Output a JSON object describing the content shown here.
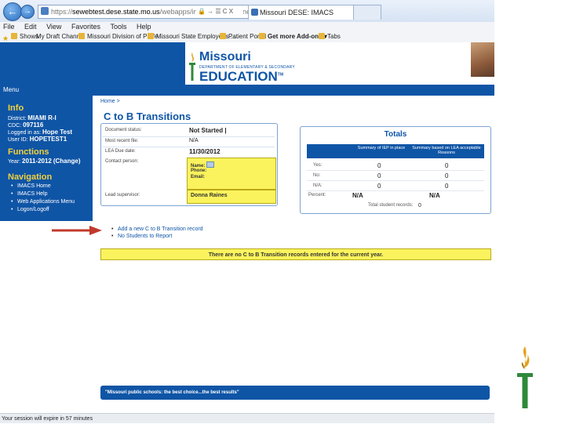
{
  "browser": {
    "url_prefix": "https://",
    "url_domain": "sewebtest.dese.state.mo.us",
    "url_path": "/webapps/imacs/app/timelines/index.aspx?",
    "url_controls": "🔒 → ☰ C X",
    "tab1": "Missouri DESE: IMACS",
    "tab1_prefix": "",
    "menu": [
      "File",
      "Edit",
      "View",
      "Favorites",
      "Tools",
      "Help"
    ],
    "favorites": [
      "Shows",
      "My Draft Channel",
      "Missouri Division of Profe...",
      "Missouri State Employees ...",
      "Patient Portal",
      "Get more Add-ons ▾",
      "Tabs"
    ],
    "back_icon": "back-arrow",
    "forward_icon": "forward-arrow"
  },
  "header": {
    "logo_title": "Missouri",
    "logo_subtitle": "DEPARTMENT OF ELEMENTARY & SECONDARY",
    "logo_main": "EDUCATION",
    "logo_tm": "TM",
    "menu_label": "Menu"
  },
  "sidebar": {
    "info_heading": "Info",
    "district_label": "District:",
    "district_value": "MIAMI R-I",
    "cdc_label": "CDC:",
    "cdc_value": "097116",
    "logged_label": "Logged in as:",
    "logged_value": "Hope Test",
    "userid_label": "User ID:",
    "userid_value": "HOPETEST1",
    "functions_heading": "Functions",
    "year_label": "Year:",
    "year_value": "2011-2012",
    "change_label": "(Change)",
    "navigation_heading": "Navigation",
    "nav_items": [
      "IMACS Home",
      "IMACS Help",
      "Web Applications Menu",
      "Logon/Logoff"
    ]
  },
  "main": {
    "breadcrumb": "Home >",
    "title": "C to B Transitions",
    "doc_status_label": "Document status:",
    "doc_status_value": "Not Started |",
    "recent_file_label": "Most recent file:",
    "recent_file_value": "N/A",
    "due_date_label": "LEA Due date:",
    "due_date_value": "11/30/2012",
    "contact_label": "Contact person:",
    "contact_name": "Name:",
    "contact_phone": "Phone:",
    "contact_email": "Email:",
    "lead_label": "Lead supervisor:",
    "lead_value": "Donna Raines"
  },
  "totals": {
    "title": "Totals",
    "col1": "Summary of IEP in place",
    "col2": "Summary based on LEA acceptable Reasons",
    "rows": [
      {
        "label": "Yes:",
        "v1": "0",
        "v2": "0"
      },
      {
        "label": "No:",
        "v1": "0",
        "v2": "0"
      },
      {
        "label": "N/A:",
        "v1": "0",
        "v2": "0"
      },
      {
        "label": "Percent:",
        "v1": "N/A",
        "v2": "N/A"
      }
    ],
    "student_records_label": "Total student records:",
    "student_records_value": "0"
  },
  "actions": [
    "Add a new C to B Transition record",
    "No Students to Report"
  ],
  "notice": "There are no C to B Transition records entered for the current year.",
  "footer_text": "\"Missouri public schools: the best choice...the best results\"",
  "status_bar": "Your session will expire in 57 minutes",
  "colors": {
    "brand_blue": "#0f55a6",
    "highlight_yellow": "#fbf35d",
    "heading_yellow": "#f3d13a",
    "arrow_red": "#c0392b"
  }
}
